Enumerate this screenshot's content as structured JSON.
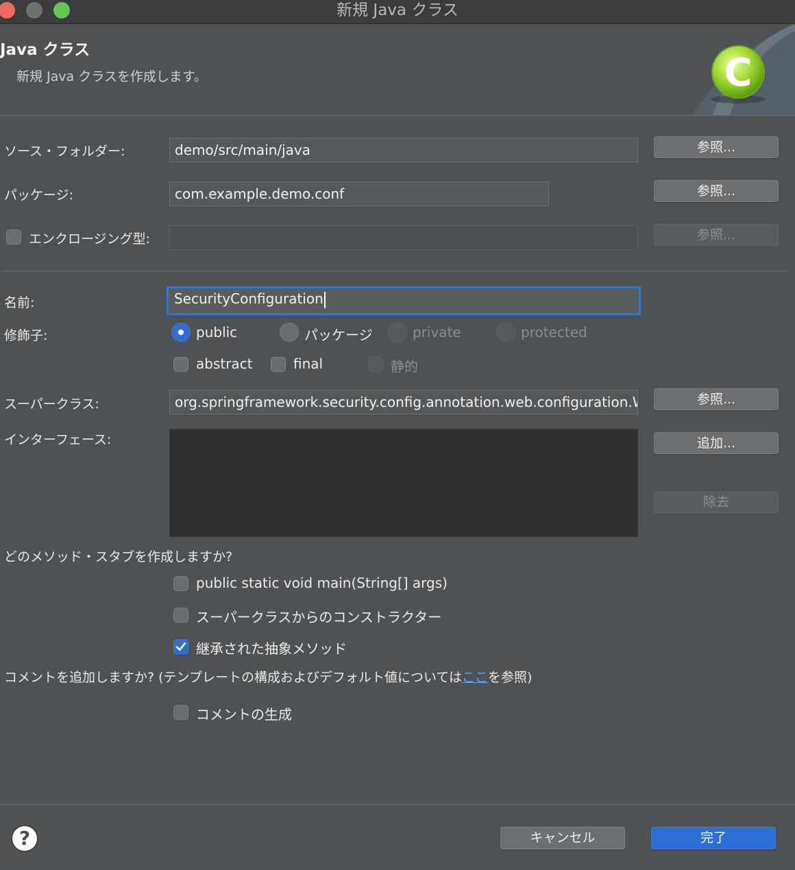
{
  "window": {
    "title": "新規 Java クラス"
  },
  "header": {
    "title": "Java クラス",
    "description": "新規 Java クラスを作成します。"
  },
  "source_folder": {
    "label": "ソース・フォルダー:",
    "value": "demo/src/main/java",
    "browse_label": "参照..."
  },
  "package": {
    "label": "パッケージ:",
    "value": "com.example.demo.conf",
    "browse_label": "参照..."
  },
  "enclosing_type": {
    "label": "エンクロージング型:",
    "checked": false,
    "value": "",
    "browse_label": "参照..."
  },
  "name": {
    "label": "名前:",
    "value": "SecurityConfiguration"
  },
  "modifiers": {
    "label": "修飾子:",
    "radios": [
      "public",
      "パッケージ",
      "private",
      "protected"
    ],
    "selected": "public",
    "checkboxes": [
      "abstract",
      "final",
      "静的"
    ]
  },
  "superclass": {
    "label": "スーパークラス:",
    "value": "org.springframework.security.config.annotation.web.configuration.WebSecurityConfigurerAdapter",
    "browse_label": "参照..."
  },
  "interfaces": {
    "label": "インターフェース:",
    "add_label": "追加...",
    "remove_label": "除去"
  },
  "method_stubs": {
    "question": "どのメソッド・スタブを作成しますか?",
    "options": [
      {
        "label": "public static void main(String[] args)",
        "checked": false
      },
      {
        "label": "スーパークラスからのコンストラクター",
        "checked": false
      },
      {
        "label": "継承された抽象メソッド",
        "checked": true
      }
    ]
  },
  "comments": {
    "question_before": "コメントを追加しますか? (テンプレートの構成およびデフォルト値については",
    "link_text": "ここ",
    "question_after": "を参照)",
    "generate_label": "コメントの生成",
    "generate_checked": false
  },
  "footer": {
    "help_glyph": "?",
    "cancel_label": "キャンセル",
    "finish_label": "完了"
  },
  "colors": {
    "accent": "#2f6fd5",
    "link": "#5aa7f5",
    "background": "#4f5255"
  }
}
